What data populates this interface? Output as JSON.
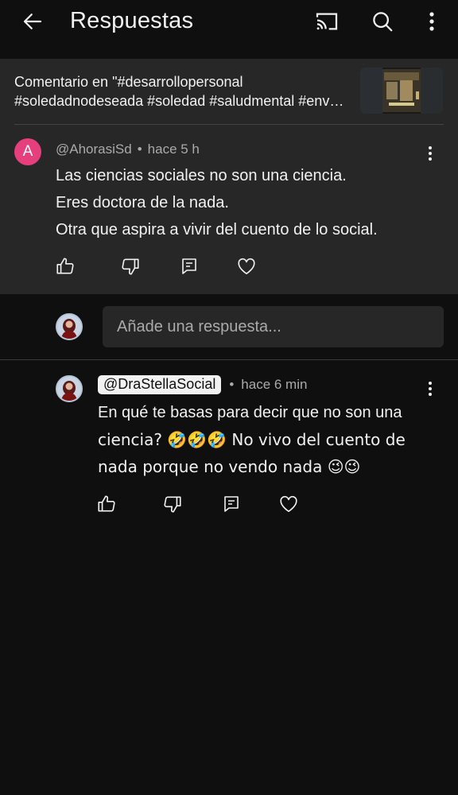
{
  "header": {
    "title": "Respuestas",
    "icons": [
      "back-arrow-icon",
      "cast-icon",
      "search-icon",
      "more-vert-icon"
    ]
  },
  "context": {
    "line1": "Comentario en \"#desarrollopersonal",
    "line2": "#soledadnodeseada #soledad #saludmental #env…"
  },
  "parent_comment": {
    "avatar_letter": "A",
    "avatar_color": "#e63f7d",
    "author": "@AhorasiSd",
    "time": "hace 5 h",
    "lines": [
      "Las ciencias sociales no son una ciencia.",
      "Eres doctora de la nada.",
      "Otra que aspira a vivir del cuento de lo social."
    ]
  },
  "reply_box": {
    "placeholder": "Añade una respuesta..."
  },
  "reply": {
    "author": "@DraStellaSocial",
    "time": "hace 6 min",
    "lines": [
      "En qué te basas para decir que no son una",
      "ciencia? 🤣🤣🤣 No vivo del cuento de",
      "nada porque no vendo nada 😉😉"
    ]
  },
  "separator": "•",
  "colors": {
    "background": "#0f0f0f",
    "panel": "#272727",
    "text": "#f1f1f1",
    "muted": "#aaaaaa"
  }
}
